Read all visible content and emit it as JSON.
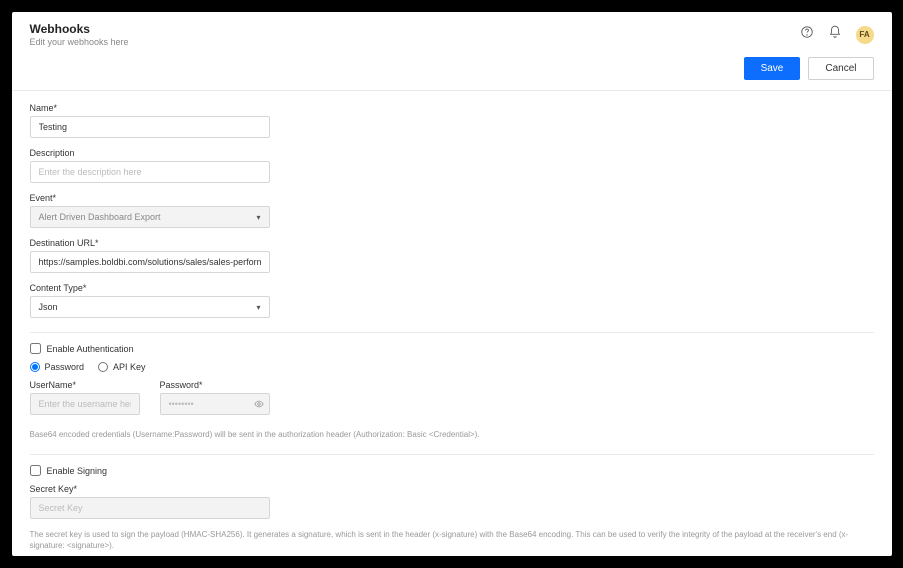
{
  "header": {
    "title": "Webhooks",
    "subtitle": "Edit your webhooks here",
    "avatar_initials": "FA"
  },
  "actions": {
    "save": "Save",
    "cancel": "Cancel"
  },
  "form": {
    "name_label": "Name*",
    "name_value": "Testing",
    "description_label": "Description",
    "description_placeholder": "Enter the description here",
    "event_label": "Event*",
    "event_value": "Alert Driven Dashboard Export",
    "destination_label": "Destination URL*",
    "destination_value": "https://samples.boldbi.com/solutions/sales/sales-performance-dashboard",
    "content_type_label": "Content Type*",
    "content_type_value": "Json"
  },
  "auth": {
    "enable_label": "Enable Authentication",
    "radio_password": "Password",
    "radio_apikey": "API Key",
    "username_label": "UserName*",
    "username_placeholder": "Enter the username here",
    "password_label": "Password*",
    "password_placeholder": "••••••••",
    "help": "Base64 encoded credentials (Username:Password) will be sent in the authorization header (Authorization: Basic <Credential>)."
  },
  "signing": {
    "enable_label": "Enable Signing",
    "secret_label": "Secret Key*",
    "secret_placeholder": "Secret Key",
    "help": "The secret key is used to sign the payload (HMAC-SHA256). It generates a signature, which is sent in the header (x-signature) with the Base64 encoding. This can be used to verify the integrity of the payload at the receiver's end (x-signature: <signature>)."
  }
}
